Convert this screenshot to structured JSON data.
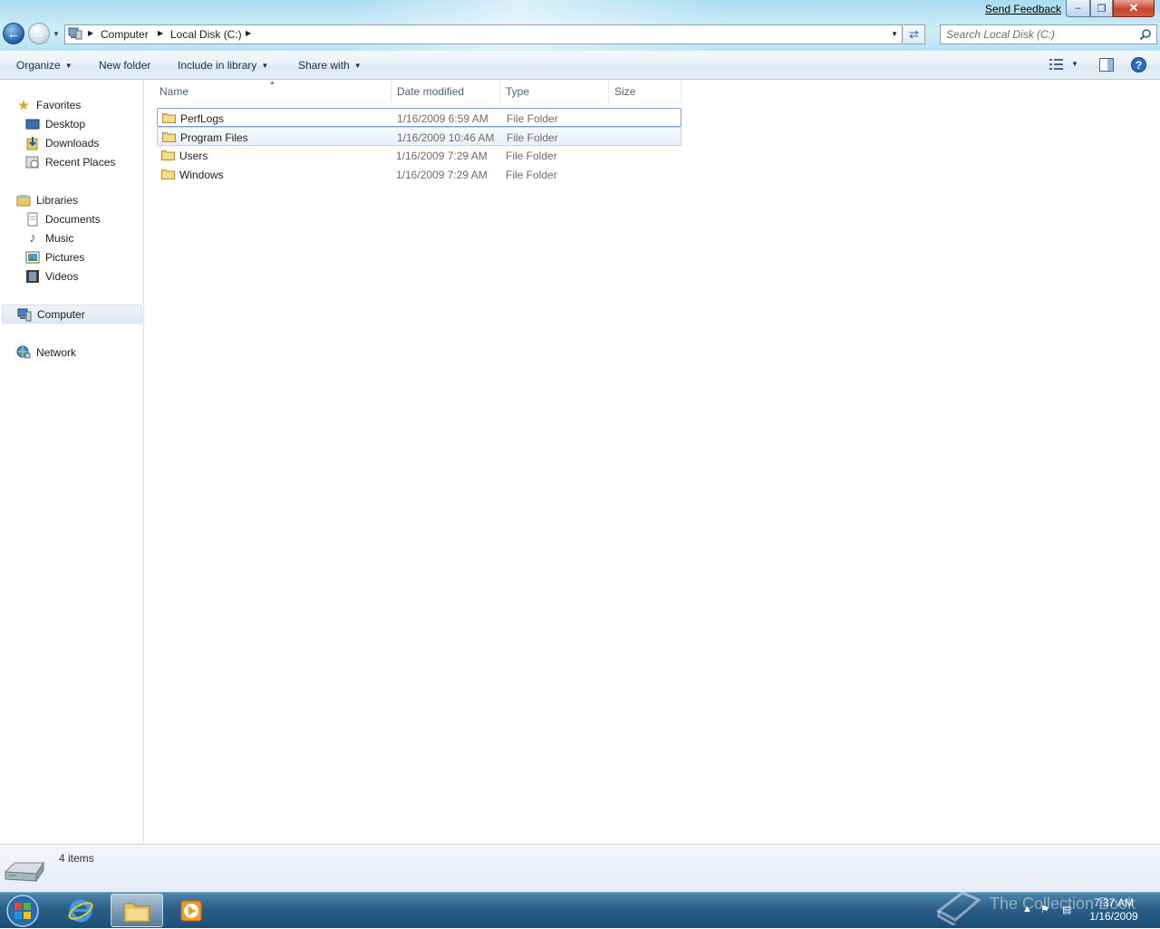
{
  "window": {
    "send_feedback": "Send Feedback",
    "minimize_glyph": "‒",
    "maximize_glyph": "❐",
    "close_glyph": "✕"
  },
  "address": {
    "crumbs": [
      "Computer",
      "Local Disk (C:)"
    ],
    "search_placeholder": "Search Local Disk (C:)"
  },
  "toolbar": {
    "organize": "Organize",
    "new_folder": "New folder",
    "include_in_library": "Include in library",
    "share_with": "Share with"
  },
  "nav": {
    "favorites": {
      "label": "Favorites",
      "items": [
        "Desktop",
        "Downloads",
        "Recent Places"
      ]
    },
    "libraries": {
      "label": "Libraries",
      "items": [
        "Documents",
        "Music",
        "Pictures",
        "Videos"
      ]
    },
    "computer": "Computer",
    "network": "Network"
  },
  "columns": [
    "Name",
    "Date modified",
    "Type",
    "Size"
  ],
  "files": [
    {
      "name": "PerfLogs",
      "date": "1/16/2009 6:59 AM",
      "type": "File Folder"
    },
    {
      "name": "Program Files",
      "date": "1/16/2009 10:46 AM",
      "type": "File Folder"
    },
    {
      "name": "Users",
      "date": "1/16/2009 7:29 AM",
      "type": "File Folder"
    },
    {
      "name": "Windows",
      "date": "1/16/2009 7:29 AM",
      "type": "File Folder"
    }
  ],
  "status": {
    "item_count": "4 items"
  },
  "taskbar": {
    "time": "7:37 AM",
    "date": "1/16/2009",
    "watermark": "The Collection Book"
  },
  "colors": {
    "accent": "#1f5fa8",
    "selection_border": "#7da2ce",
    "hover_fill": "#e6f1fd",
    "taskbar": "#2a5f88"
  }
}
